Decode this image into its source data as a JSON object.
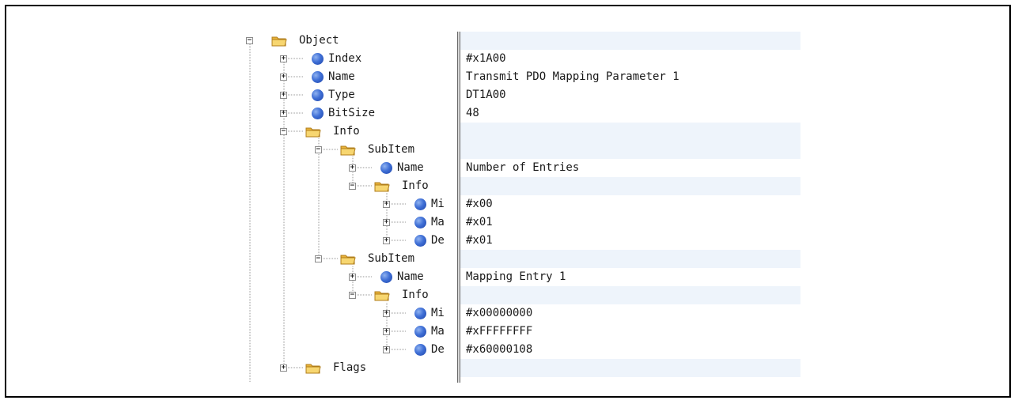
{
  "tree": {
    "root_label": "Object",
    "nodes": [
      {
        "id": "index",
        "label": "Index",
        "value": "#x1A00",
        "kind": "leaf"
      },
      {
        "id": "name",
        "label": "Name",
        "value": "Transmit PDO Mapping Parameter 1",
        "kind": "leaf"
      },
      {
        "id": "type",
        "label": "Type",
        "value": "DT1A00",
        "kind": "leaf"
      },
      {
        "id": "bitsize",
        "label": "BitSize",
        "value": "48",
        "kind": "leaf"
      },
      {
        "id": "info",
        "label": "Info",
        "value": "",
        "kind": "folder"
      },
      {
        "id": "sub1",
        "label": "SubItem",
        "value": "",
        "kind": "folder"
      },
      {
        "id": "sub1name",
        "label": "Name",
        "value": "Number of Entries",
        "kind": "leaf"
      },
      {
        "id": "sub1info",
        "label": "Info",
        "value": "",
        "kind": "folder"
      },
      {
        "id": "sub1min",
        "label": "Mi",
        "value": "#x00",
        "kind": "leaf"
      },
      {
        "id": "sub1max",
        "label": "Ma",
        "value": "#x01",
        "kind": "leaf"
      },
      {
        "id": "sub1def",
        "label": "De",
        "value": "#x01",
        "kind": "leaf"
      },
      {
        "id": "sub2",
        "label": "SubItem",
        "value": "",
        "kind": "folder"
      },
      {
        "id": "sub2name",
        "label": "Name",
        "value": "Mapping Entry 1",
        "kind": "leaf"
      },
      {
        "id": "sub2info",
        "label": "Info",
        "value": "",
        "kind": "folder"
      },
      {
        "id": "sub2min",
        "label": "Mi",
        "value": "#x00000000",
        "kind": "leaf"
      },
      {
        "id": "sub2max",
        "label": "Ma",
        "value": "#xFFFFFFFF",
        "kind": "leaf"
      },
      {
        "id": "sub2def",
        "label": "De",
        "value": "#x60000108",
        "kind": "leaf"
      },
      {
        "id": "flags",
        "label": "Flags",
        "value": "",
        "kind": "folder"
      }
    ],
    "expanders": {
      "expanded": "−",
      "collapsed": "+"
    }
  },
  "icons": {
    "folder": "folder-icon",
    "leaf": "blue-dot-icon"
  },
  "colors": {
    "highlight": "#eef4fb",
    "dot": "#3f6fd6",
    "folder": "#f3c24a"
  }
}
